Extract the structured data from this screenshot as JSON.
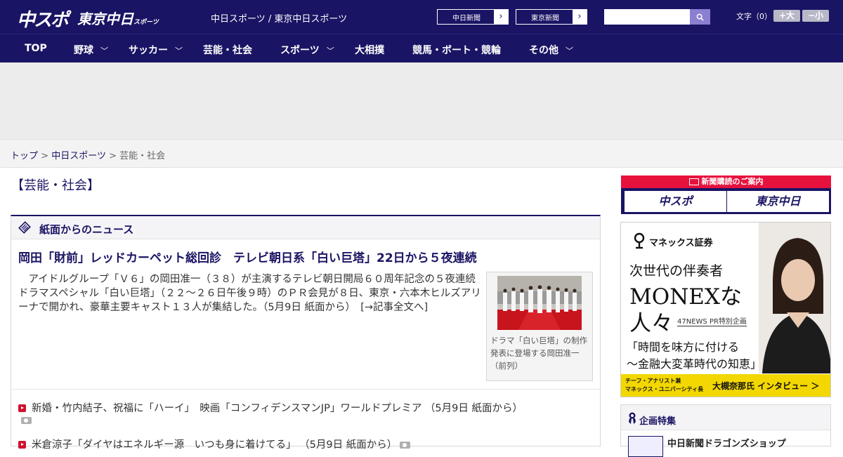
{
  "header": {
    "logo_main": "中スポ",
    "logo_sub": "東京中日",
    "logo_sub_small": "スポーツ",
    "site_title": "中日スポーツ / 東京中日スポーツ",
    "links": [
      {
        "label": "中日新聞"
      },
      {
        "label": "東京新聞"
      }
    ],
    "search_placeholder": "",
    "font_size_label": "文字（0）",
    "font_bigger": "+大",
    "font_smaller": "−小"
  },
  "nav": {
    "items": [
      {
        "label": "TOP",
        "has_menu": false
      },
      {
        "label": "野球",
        "has_menu": true
      },
      {
        "label": "サッカー",
        "has_menu": true
      },
      {
        "label": "芸能・社会",
        "has_menu": false
      },
      {
        "label": "スポーツ",
        "has_menu": true
      },
      {
        "label": "大相撲",
        "has_menu": false
      },
      {
        "label": "競馬・ボート・競輪",
        "has_menu": false
      },
      {
        "label": "その他",
        "has_menu": true
      }
    ]
  },
  "breadcrumb": {
    "home": "トップ",
    "parent": "中日スポーツ",
    "current": "芸能・社会",
    "separator": ">"
  },
  "section_title": "【芸能・社会】",
  "news_box": {
    "header": "紙面からのニュース",
    "headline": "岡田「財前」レッドカーペット総回診　テレビ朝日系「白い巨塔」22日から５夜連続",
    "lead": "　アイドルグループ「Ｖ６」の岡田准一（３８）が主演するテレビ朝日開局６０周年記念の５夜連続ドラマスペシャル「白い巨塔」（２２～２６日午後９時）のＰＲ会見が８日、東京・六本木ヒルズアリーナで開かれ、豪華主要キャスト１３人が集結した。（5月9日 紙面から）　[→記事全文へ]",
    "photo_caption": "ドラマ「白い巨塔」の制作発表に登場する岡田准一（前列）",
    "items": [
      {
        "text": "新婚・竹内結子、祝福に「ハーイ」　映画「コンフィデンスマンJP」ワールドプレミア （5月9日 紙面から）",
        "has_photo": true
      },
      {
        "text": "米倉涼子「ダイヤはエネルギー源　いつも身に着けてる」 （5月9日 紙面から）",
        "has_photo": true
      }
    ]
  },
  "sidebar": {
    "subscribe_header": "新聞購読のご案内",
    "subscribe_buttons": [
      "中スポ",
      "東京中日"
    ],
    "ad": {
      "brand": "マネックス証券",
      "line1": "次世代の伴奏者",
      "line2": "MONEXな",
      "line3": "人々",
      "line3_note": "47NEWS PR特別企画",
      "line4": "「時間を味方に付ける",
      "line5": "～金融大変革時代の知恵」",
      "bottom_small_1": "チーフ・アナリスト兼",
      "bottom_small_2": "マネックス・ユニバーシティ長",
      "bottom_big": "大槻奈那氏 インタビュー ＞"
    },
    "special_header": "企画特集",
    "special_item": "中日新聞ドラゴンズショップ"
  }
}
